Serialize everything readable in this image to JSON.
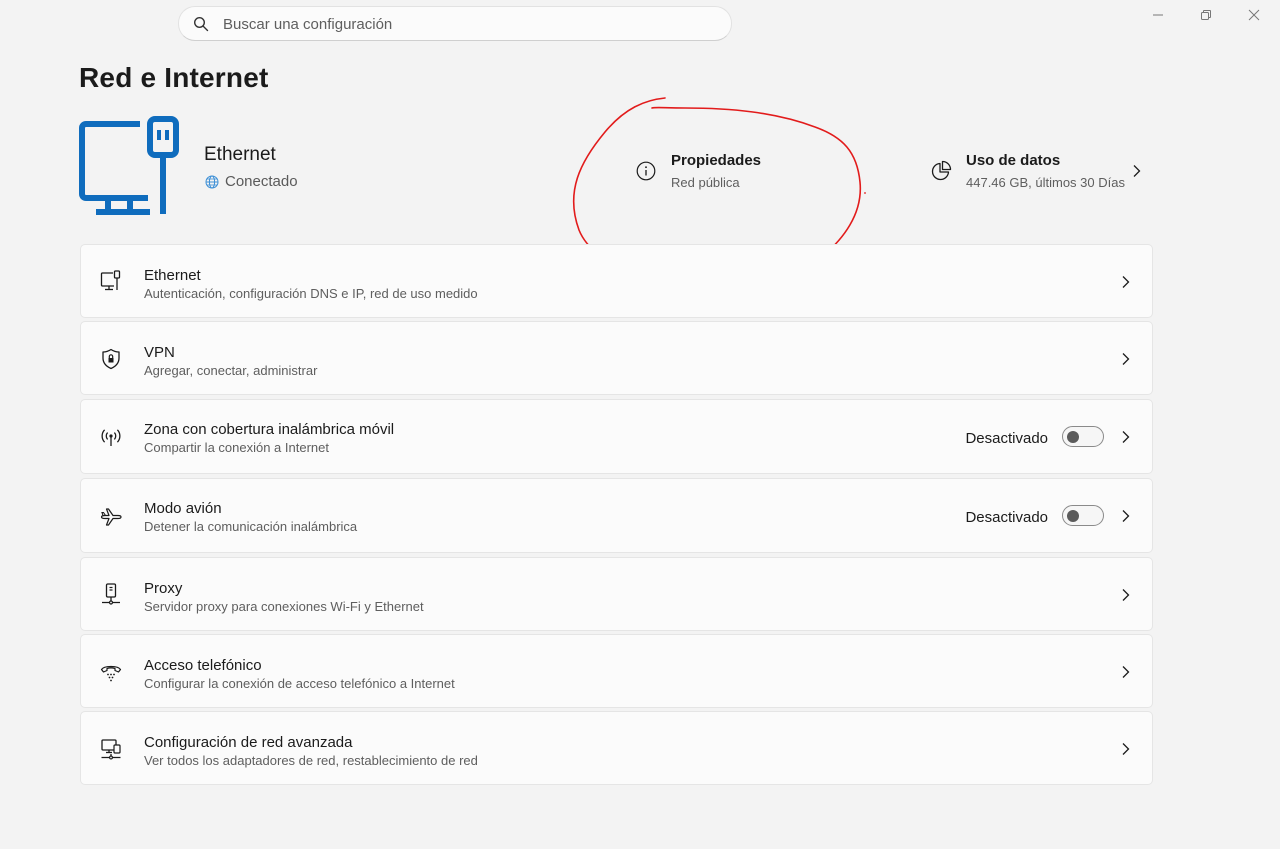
{
  "search": {
    "placeholder": "Buscar una configuración",
    "icon": "search-icon"
  },
  "window_controls": [
    "minimize-icon",
    "restore-icon",
    "close-icon"
  ],
  "page": {
    "title": "Red e Internet"
  },
  "connection": {
    "name": "Ethernet",
    "status": "Conectado",
    "icon": "ethernet-pc-icon",
    "status_icon": "globe-icon",
    "accent": "#0f6cbd"
  },
  "properties": {
    "title": "Propiedades",
    "subtitle": "Red pública",
    "icon": "info-icon"
  },
  "data_usage": {
    "title": "Uso de datos",
    "subtitle": "447.46 GB, últimos 30 Días",
    "icon": "pie-chart-icon"
  },
  "annotation": {
    "color": "#e21b1b",
    "shape": "hand-drawn circle around Propiedades"
  },
  "settings": [
    {
      "title": "Ethernet",
      "subtitle": "Autenticación, configuración DNS e IP, red de uso medido",
      "icon": "ethernet-icon"
    },
    {
      "title": "VPN",
      "subtitle": "Agregar, conectar, administrar",
      "icon": "shield-icon"
    },
    {
      "title": "Zona con cobertura inalámbrica móvil",
      "subtitle": "Compartir la conexión a Internet",
      "icon": "hotspot-icon",
      "state": "Desactivado",
      "toggle_on": false
    },
    {
      "title": "Modo avión",
      "subtitle": "Detener la comunicación inalámbrica",
      "icon": "airplane-icon",
      "state": "Desactivado",
      "toggle_on": false
    },
    {
      "title": "Proxy",
      "subtitle": "Servidor proxy para conexiones Wi-Fi y Ethernet",
      "icon": "proxy-icon"
    },
    {
      "title": "Acceso telefónico",
      "subtitle": "Configurar la conexión de acceso telefónico a Internet",
      "icon": "dialup-phone-icon"
    },
    {
      "title": "Configuración de red avanzada",
      "subtitle": "Ver todos los adaptadores de red, restablecimiento de red",
      "icon": "network-pc-icon"
    }
  ]
}
